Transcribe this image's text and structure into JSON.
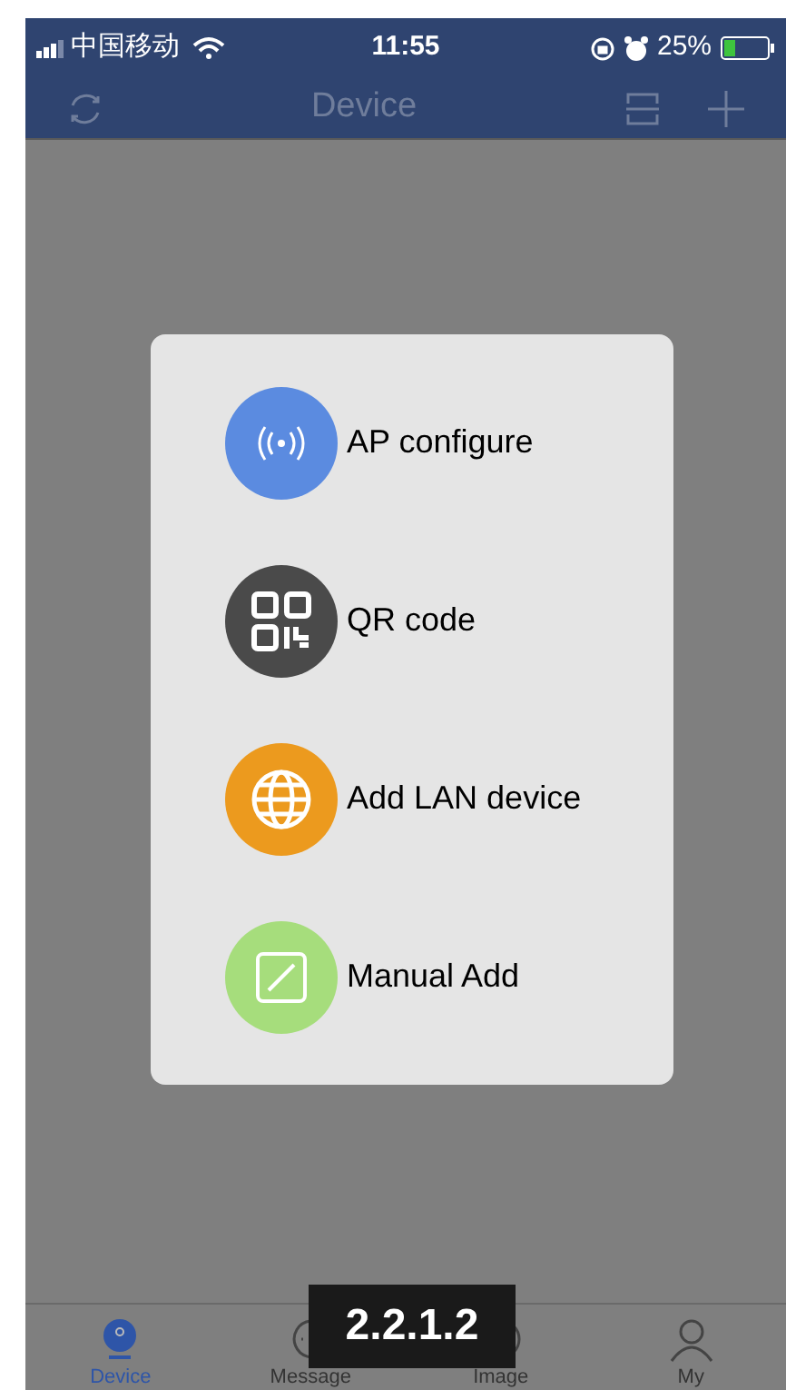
{
  "status_bar": {
    "carrier": "中国移动",
    "time": "11:55",
    "battery": "25%"
  },
  "nav_bar": {
    "title": "Device"
  },
  "add_menu": {
    "items": [
      {
        "kind": "ap",
        "label": "AP configure"
      },
      {
        "kind": "qr",
        "label": "QR code"
      },
      {
        "kind": "lan",
        "label": "Add LAN device"
      },
      {
        "kind": "manual",
        "label": "Manual Add"
      }
    ]
  },
  "tab_bar": {
    "tabs": [
      {
        "kind": "device",
        "label": "Device",
        "selected": true
      },
      {
        "kind": "message",
        "label": "Message",
        "selected": false
      },
      {
        "kind": "image",
        "label": "Image",
        "selected": false
      },
      {
        "kind": "my",
        "label": "My",
        "selected": false
      }
    ]
  },
  "figure_label": "2.2.1.2"
}
